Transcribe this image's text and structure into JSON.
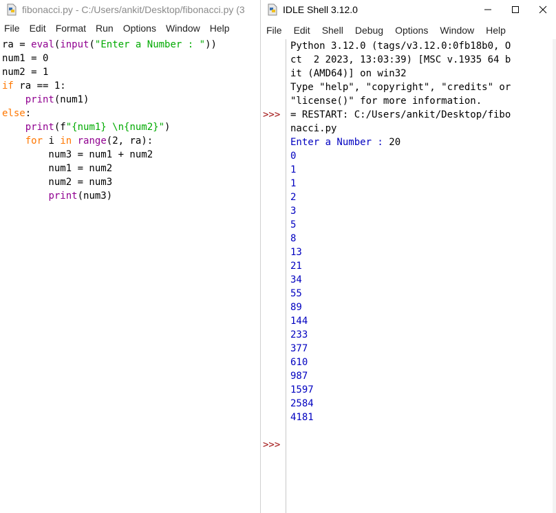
{
  "editor": {
    "title": "fibonacci.py - C:/Users/ankit/Desktop/fibonacci.py (3",
    "menu": [
      "File",
      "Edit",
      "Format",
      "Run",
      "Options",
      "Window",
      "Help"
    ],
    "code": [
      {
        "t": "ra = ",
        "seg": [
          [
            "",
            "ra = "
          ],
          [
            "bi",
            "eval"
          ],
          [
            "",
            "("
          ],
          [
            "bi",
            "input"
          ],
          [
            "",
            "("
          ],
          [
            "str",
            "\"Enter a Number : \""
          ],
          [
            "",
            "))"
          ]
        ]
      },
      {
        "seg": [
          [
            "",
            "num1 = 0"
          ]
        ]
      },
      {
        "seg": [
          [
            "",
            "num2 = 1"
          ]
        ]
      },
      {
        "seg": [
          [
            "kw",
            "if"
          ],
          [
            "",
            " ra == 1:"
          ]
        ]
      },
      {
        "seg": [
          [
            "",
            "    "
          ],
          [
            "bi",
            "print"
          ],
          [
            "",
            "(num1)"
          ]
        ]
      },
      {
        "seg": [
          [
            "kw",
            "else"
          ],
          [
            "",
            ":"
          ]
        ]
      },
      {
        "seg": [
          [
            "",
            "    "
          ],
          [
            "bi",
            "print"
          ],
          [
            "",
            "(f"
          ],
          [
            "str",
            "\"{num1} \\n{num2}\""
          ],
          [
            "",
            ")"
          ]
        ]
      },
      {
        "seg": [
          [
            "",
            "    "
          ],
          [
            "kw",
            "for"
          ],
          [
            "",
            " i "
          ],
          [
            "kw",
            "in"
          ],
          [
            "",
            " "
          ],
          [
            "bi",
            "range"
          ],
          [
            "",
            "(2, ra):"
          ]
        ]
      },
      {
        "seg": [
          [
            "",
            "        num3 = num1 + num2"
          ]
        ]
      },
      {
        "seg": [
          [
            "",
            "        num1 = num2"
          ]
        ]
      },
      {
        "seg": [
          [
            "",
            "        num2 = num3"
          ]
        ]
      },
      {
        "seg": [
          [
            "",
            "        "
          ],
          [
            "bi",
            "print"
          ],
          [
            "",
            "(num3)"
          ]
        ]
      }
    ]
  },
  "shell": {
    "title": "IDLE Shell 3.12.0",
    "menu": [
      "File",
      "Edit",
      "Shell",
      "Debug",
      "Options",
      "Window",
      "Help"
    ],
    "prompt": ">>>",
    "banner": [
      "Python 3.12.0 (tags/v3.12.0:0fb18b0, O",
      "ct  2 2023, 13:03:39) [MSC v.1935 64 b",
      "it (AMD64)] on win32",
      "Type \"help\", \"copyright\", \"credits\" or",
      "\"license()\" for more information."
    ],
    "restart_lines": [
      "= RESTART: C:/Users/ankit/Desktop/fibo",
      "nacci.py"
    ],
    "input_prompt": "Enter a Number : ",
    "input_value": "20",
    "output": [
      "0",
      "1",
      "1",
      "2",
      "3",
      "5",
      "8",
      "13",
      "21",
      "34",
      "55",
      "89",
      "144",
      "233",
      "377",
      "610",
      "987",
      "1597",
      "2584",
      "4181"
    ]
  },
  "colors": {
    "keyword": "#ff7700",
    "builtin": "#900090",
    "string": "#00aa00",
    "output": "#0000c0",
    "prompt": "#a01010"
  }
}
